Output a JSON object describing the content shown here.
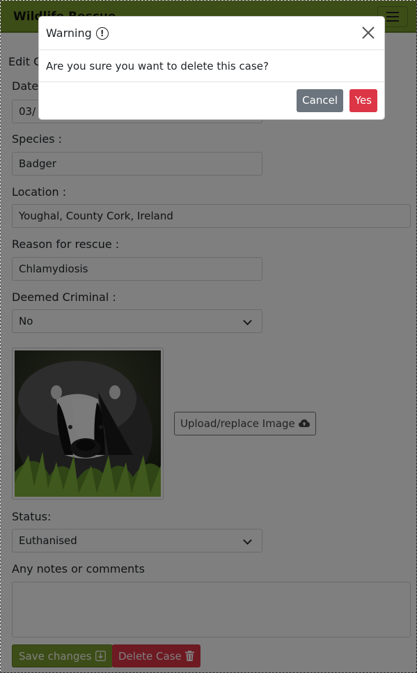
{
  "app": {
    "brand": "Wildlife Rescue"
  },
  "page": {
    "title": "Edit Case"
  },
  "form": {
    "date_label": "Date",
    "date_value": "03/",
    "species_label": "Species :",
    "species_value": "Badger",
    "location_label": "Location :",
    "location_value": "Youghal, County Cork, Ireland",
    "reason_label": "Reason for rescue :",
    "reason_value": "Chlamydiosis",
    "criminal_label": "Deemed Criminal :",
    "criminal_value": "No",
    "upload_label": "Upload/replace Image",
    "status_label": "Status:",
    "status_value": "Euthanised",
    "notes_label": "Any notes or comments",
    "notes_value": "",
    "save_label": "Save changes",
    "delete_label": "Delete Case"
  },
  "modal": {
    "title": "Warning",
    "message": "Are you sure you want to delete this case?",
    "cancel_label": "Cancel",
    "yes_label": "Yes"
  },
  "colors": {
    "navbar": "#7a9b2e",
    "danger": "#dc3545",
    "secondary": "#6c757d"
  }
}
